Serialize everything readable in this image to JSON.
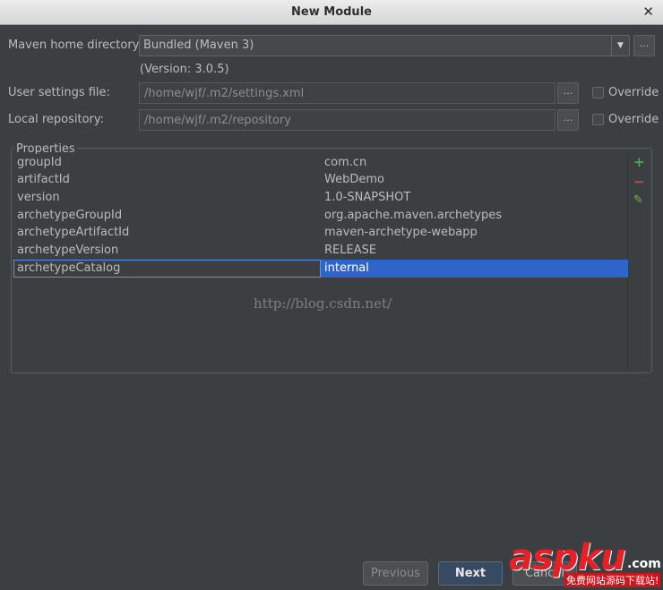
{
  "window": {
    "title": "New Module"
  },
  "maven": {
    "home_label": "Maven home directory:",
    "home_value": "Bundled (Maven 3)",
    "version_text": "(Version: 3.0.5)",
    "settings_label": "User settings file:",
    "settings_value": "/home/wjf/.m2/settings.xml",
    "repo_label": "Local repository:",
    "repo_value": "/home/wjf/.m2/repository",
    "override_label": "Override",
    "browse_label": "..."
  },
  "properties": {
    "legend": "Properties",
    "rows": [
      {
        "key": "groupId",
        "value": "com.cn"
      },
      {
        "key": "artifactId",
        "value": "WebDemo"
      },
      {
        "key": "version",
        "value": "1.0-SNAPSHOT"
      },
      {
        "key": "archetypeGroupId",
        "value": "org.apache.maven.archetypes"
      },
      {
        "key": "archetypeArtifactId",
        "value": "maven-archetype-webapp"
      },
      {
        "key": "archetypeVersion",
        "value": "RELEASE"
      },
      {
        "key": "archetypeCatalog",
        "value": "internal"
      }
    ],
    "toolbar": {
      "add": "+",
      "remove": "−",
      "edit": "✎"
    }
  },
  "watermark": "http://blog.csdn.net/",
  "buttons": {
    "previous": "Previous",
    "next": "Next",
    "cancel": "Cancel"
  },
  "logo": {
    "text": "aspku",
    "suffix": ".com",
    "sub": "免费网站源码下载站!"
  },
  "colors": {
    "selection": "#2f65ca",
    "add": "#3fb13f",
    "remove": "#d9453b",
    "edit": "#6abf3d"
  }
}
